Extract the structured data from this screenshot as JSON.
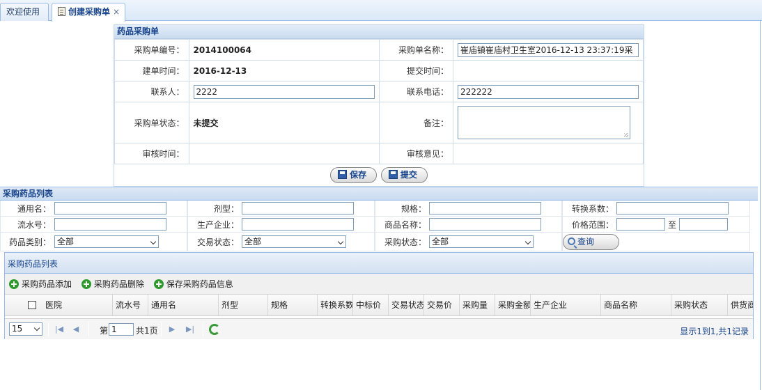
{
  "tabs": [
    {
      "label": "欢迎使用"
    },
    {
      "label": "创建采购单",
      "close": "×"
    }
  ],
  "form": {
    "title": "药品采购单",
    "order_no_label": "采购单编号：",
    "order_no": "2014100064",
    "order_name_label": "采购单名称：",
    "order_name": "崔庙镇崔庙村卫生室2016-12-13 23:37:19采",
    "create_time_label": "建单时间：",
    "create_time": "2016-12-13",
    "submit_time_label": "提交时间：",
    "submit_time": "",
    "contact_label": "联系人：",
    "contact": "2222",
    "phone_label": "联系电话：",
    "phone": "222222",
    "status_label": "采购单状态：",
    "status": "未提交",
    "remark_label": "备注：",
    "audit_time_label": "审核时间：",
    "audit_opinion_label": "审核意见：",
    "save_label": "保存",
    "submit_label": "提交"
  },
  "filter": {
    "section_title": "采购药品列表",
    "generic_name": "通用名：",
    "dosage_form": "剂型：",
    "spec": "规格：",
    "conversion": "转换系数：",
    "serial_no": "流水号：",
    "manufacturer": "生产企业：",
    "product_name": "商品名称：",
    "price_range": "价格范围：",
    "to": "至",
    "category": "药品类别：",
    "category_value": "全部",
    "trade_status": "交易状态：",
    "trade_status_value": "全部",
    "purchase_status": "采购状态：",
    "purchase_status_value": "全部",
    "query_label": "查询"
  },
  "grid": {
    "title": "采购药品列表",
    "toolbar": {
      "add": "采购药品添加",
      "delete": "采购药品删除",
      "save": "保存采购药品信息"
    },
    "columns": [
      "医院",
      "流水号",
      "通用名",
      "剂型",
      "规格",
      "转换系数",
      "中标价",
      "交易状态",
      "交易价",
      "采购量",
      "采购金额",
      "生产企业",
      "商品名称",
      "采购状态",
      "供货商"
    ],
    "pager": {
      "page_size": "15",
      "page_prefix": "第",
      "page": "1",
      "page_total": "共1页",
      "info": "显示1到1,共1记录"
    }
  }
}
